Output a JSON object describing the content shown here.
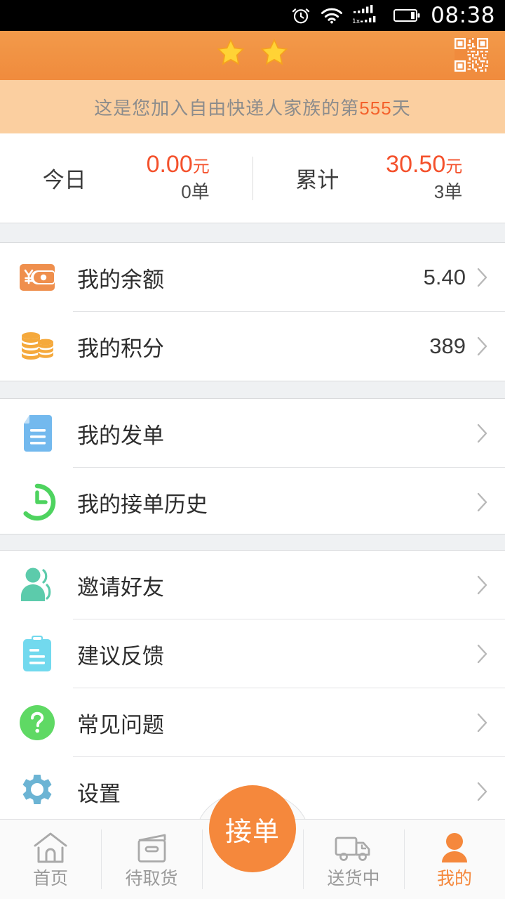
{
  "statusbar": {
    "time": "08:38",
    "network_label": "1x",
    "icons": [
      "alarm-icon",
      "wifi-icon",
      "signal-icon",
      "signal-icon-2",
      "battery-icon"
    ]
  },
  "header": {
    "stars": 2,
    "star_icon": "star-icon",
    "qr_icon": "qr-code-icon",
    "accent_color": "#f08b3d"
  },
  "banner": {
    "prefix": "这是您加入自由快递人家族的第",
    "days": "555",
    "suffix": "天",
    "background": "#fbcfa0",
    "number_color": "#f4622c"
  },
  "stats": [
    {
      "label": "今日",
      "amount": "0.00",
      "unit": "元",
      "orders": "0单"
    },
    {
      "label": "累计",
      "amount": "30.50",
      "unit": "元",
      "orders": "3单"
    }
  ],
  "groups": [
    {
      "rows": [
        {
          "label": "我的余额",
          "value": "5.40",
          "icon": "wallet-icon"
        },
        {
          "label": "我的积分",
          "value": "389",
          "icon": "coins-icon"
        }
      ]
    },
    {
      "rows": [
        {
          "label": "我的发单",
          "value": "",
          "icon": "document-icon"
        },
        {
          "label": "我的接单历史",
          "value": "",
          "icon": "history-clock-icon"
        }
      ]
    },
    {
      "rows": [
        {
          "label": "邀请好友",
          "value": "",
          "icon": "invite-friends-icon"
        },
        {
          "label": "建议反馈",
          "value": "",
          "icon": "clipboard-icon"
        },
        {
          "label": "常见问题",
          "value": "",
          "icon": "question-circle-icon"
        },
        {
          "label": "设置",
          "value": "",
          "icon": "gear-icon"
        }
      ]
    }
  ],
  "nav": {
    "items": [
      {
        "label": "首页",
        "icon": "home-icon",
        "active": false
      },
      {
        "label": "待取货",
        "icon": "package-icon",
        "active": false
      },
      {
        "label": "送货中",
        "icon": "truck-icon",
        "active": false
      },
      {
        "label": "我的",
        "icon": "person-icon",
        "active": true
      }
    ],
    "fab_label": "接单",
    "fab_color": "#f5883c",
    "active_color": "#f5883c",
    "inactive_color": "#9a9a9a"
  }
}
